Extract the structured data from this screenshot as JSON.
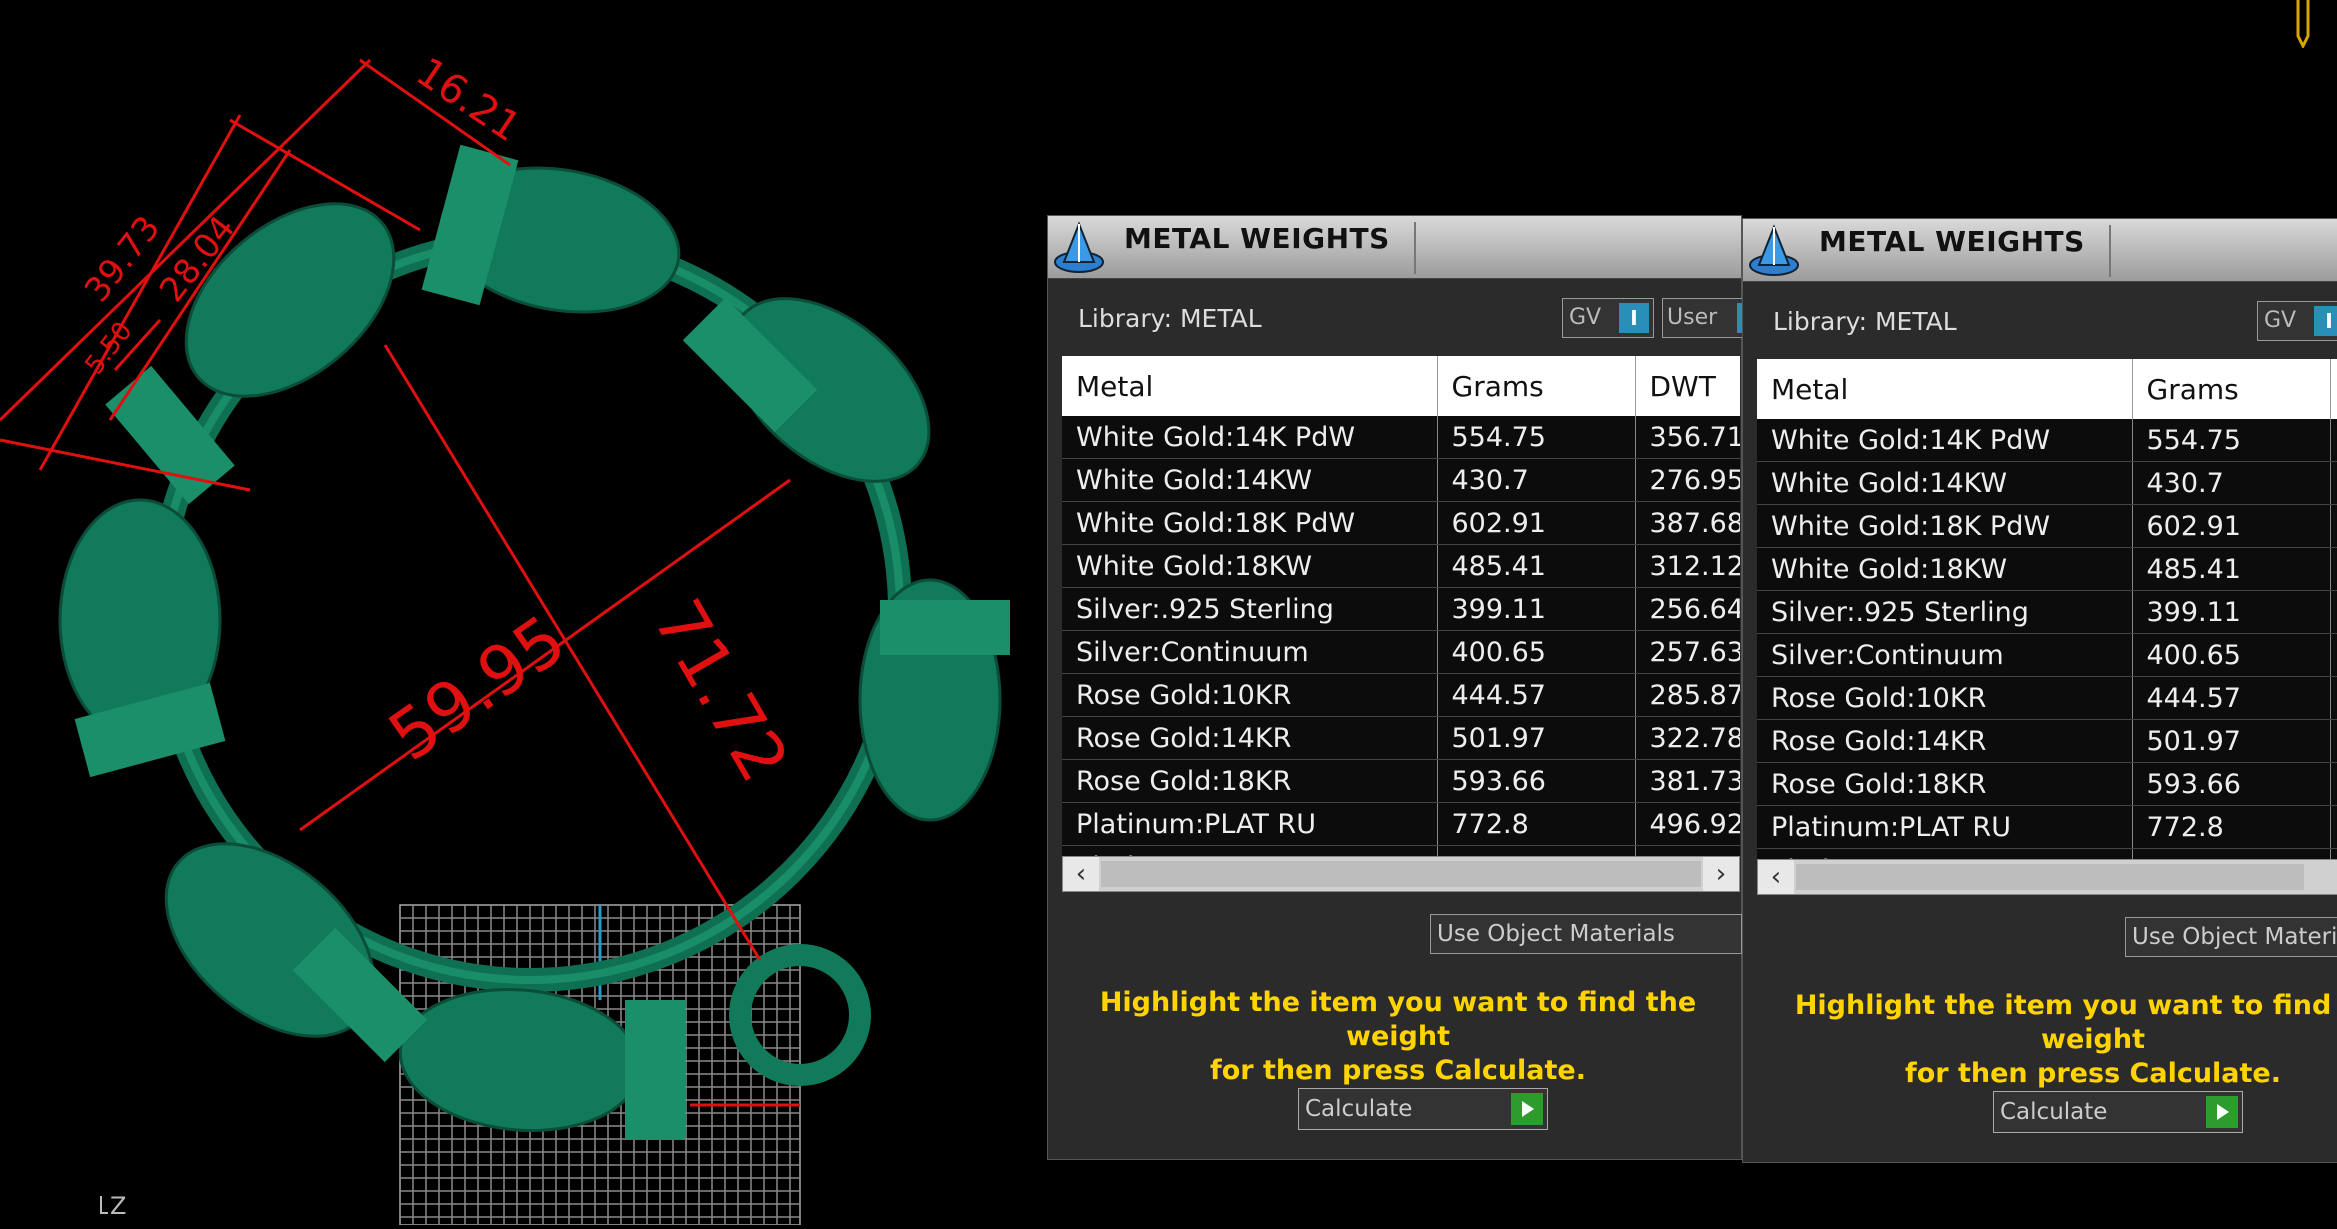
{
  "viewport": {
    "dimensions": [
      "16.21",
      "39.73",
      "28.04",
      "5.50",
      "59.95",
      "71.72"
    ],
    "axis_label": "Z",
    "colors": {
      "model": "#0f6f52",
      "dimension_lines": "#e01010",
      "grid": "#8a8a8a"
    }
  },
  "panels": [
    {
      "title": "METAL WEIGHTS",
      "library": "Library: METAL",
      "gv_label": "GV",
      "toggle_label": "I",
      "user_label": "User",
      "columns": [
        "Metal",
        "Grams",
        "DWT"
      ],
      "rows": [
        [
          "White Gold:14K PdW",
          "554.75",
          "356.71"
        ],
        [
          "White Gold:14KW",
          "430.7",
          "276.95"
        ],
        [
          "White Gold:18K PdW",
          "602.91",
          "387.68"
        ],
        [
          "White Gold:18KW",
          "485.41",
          "312.12"
        ],
        [
          "Silver:.925 Sterling",
          "399.11",
          "256.64"
        ],
        [
          "Silver:Continuum",
          "400.65",
          "257.63"
        ],
        [
          "Rose Gold:10KR",
          "444.57",
          "285.87"
        ],
        [
          "Rose Gold:14KR",
          "501.97",
          "322.78"
        ],
        [
          "Rose Gold:18KR",
          "593.66",
          "381.73"
        ],
        [
          "Platinum:PLAT RU",
          "772.8",
          "496.92"
        ],
        [
          "Platinum:PLAT",
          "",
          ""
        ]
      ],
      "use_object_materials": "Use Object Materials",
      "hint_line1": "Highlight the item you want to find the weight",
      "hint_line2": "for then press Calculate.",
      "calculate": "Calculate"
    },
    {
      "title": "METAL WEIGHTS",
      "library": "Library: METAL",
      "gv_label": "GV",
      "toggle_label": "I",
      "columns": [
        "Metal",
        "Grams"
      ],
      "rows": [
        [
          "White Gold:14K PdW",
          "554.75"
        ],
        [
          "White Gold:14KW",
          "430.7"
        ],
        [
          "White Gold:18K PdW",
          "602.91"
        ],
        [
          "White Gold:18KW",
          "485.41"
        ],
        [
          "Silver:.925 Sterling",
          "399.11"
        ],
        [
          "Silver:Continuum",
          "400.65"
        ],
        [
          "Rose Gold:10KR",
          "444.57"
        ],
        [
          "Rose Gold:14KR",
          "501.97"
        ],
        [
          "Rose Gold:18KR",
          "593.66"
        ],
        [
          "Platinum:PLAT RU",
          "772.8"
        ],
        [
          "Platinum:PLAT",
          ""
        ]
      ],
      "use_object_materials": "Use Object Materials",
      "hint_line1": "Highlight the item you want to find the weight",
      "hint_line2": "for then press Calculate.",
      "calculate": "Calculate"
    }
  ]
}
